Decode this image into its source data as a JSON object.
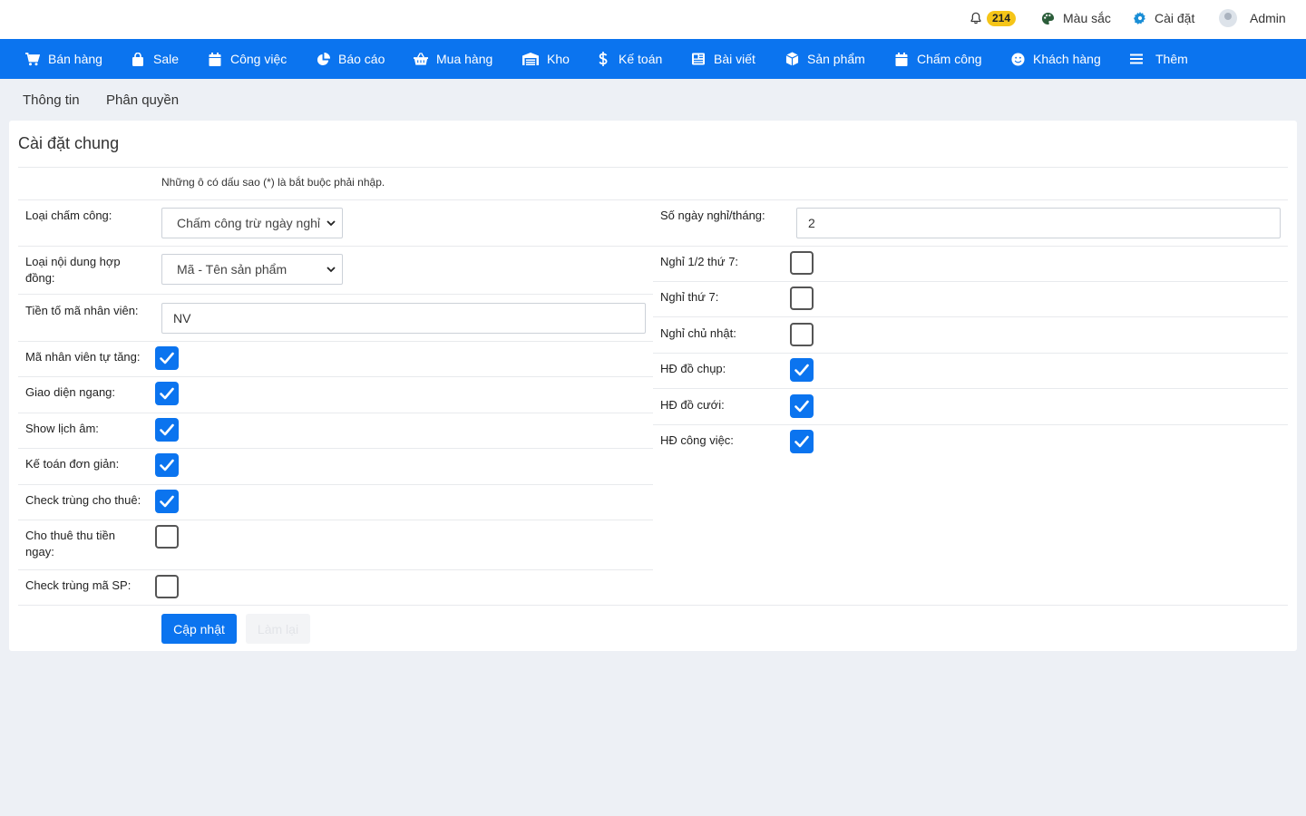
{
  "topbar": {
    "notification_count": "214",
    "color_label": "Màu sắc",
    "settings_label": "Cài đặt",
    "user_label": "Admin"
  },
  "nav": {
    "items": [
      {
        "label": "Bán hàng",
        "icon": "cart-icon"
      },
      {
        "label": "Sale",
        "icon": "bag-icon"
      },
      {
        "label": "Công việc",
        "icon": "calendar-icon"
      },
      {
        "label": "Báo cáo",
        "icon": "pie-chart-icon"
      },
      {
        "label": "Mua hàng",
        "icon": "basket-icon"
      },
      {
        "label": "Kho",
        "icon": "warehouse-icon"
      },
      {
        "label": "Kế toán",
        "icon": "dollar-icon"
      },
      {
        "label": "Bài viết",
        "icon": "newspaper-icon"
      },
      {
        "label": "Sản phẩm",
        "icon": "box-icon"
      },
      {
        "label": "Chấm công",
        "icon": "calendar-icon"
      },
      {
        "label": "Khách hàng",
        "icon": "smile-icon"
      },
      {
        "label": "Thêm",
        "icon": "menu-icon"
      }
    ]
  },
  "tabs": [
    "Thông tin",
    "Phân quyền"
  ],
  "card": {
    "title": "Cài đặt chung",
    "note": "Những ô có dấu sao (*) là bắt buộc phải nhập."
  },
  "left": {
    "attendance_type_label": "Loại chấm công:",
    "attendance_type_value": "Chấm công trừ ngày nghỉ",
    "contract_content_label": "Loại nội dung hợp đồng:",
    "contract_content_value": "Mã - Tên sản phẩm",
    "employee_prefix_label": "Tiền tố mã nhân viên:",
    "employee_prefix_value": "NV",
    "checkboxes": [
      {
        "label": "Mã nhân viên tự tăng:",
        "checked": true
      },
      {
        "label": "Giao diện ngang:",
        "checked": true
      },
      {
        "label": "Show lịch âm:",
        "checked": true
      },
      {
        "label": "Kế toán đơn giản:",
        "checked": true
      },
      {
        "label": "Check trùng cho thuê:",
        "checked": true
      },
      {
        "label": "Cho thuê thu tiền ngay:",
        "checked": false
      },
      {
        "label": "Check trùng mã SP:",
        "checked": false
      }
    ]
  },
  "right": {
    "days_off_label": "Số ngày nghỉ/tháng:",
    "days_off_value": "2",
    "checkboxes": [
      {
        "label": "Nghỉ 1/2 thứ 7:",
        "checked": false
      },
      {
        "label": "Nghỉ thứ 7:",
        "checked": false
      },
      {
        "label": "Nghỉ chủ nhật:",
        "checked": false
      },
      {
        "label": "HĐ đồ chụp:",
        "checked": true
      },
      {
        "label": "HĐ đồ cưới:",
        "checked": true
      },
      {
        "label": "HĐ công việc:",
        "checked": true
      }
    ]
  },
  "buttons": {
    "update_label": "Cập nhật",
    "reset_label": "Làm lại"
  },
  "colors": {
    "primary": "#0b74ef",
    "badge": "#f5c518",
    "background": "#edf0f5"
  }
}
